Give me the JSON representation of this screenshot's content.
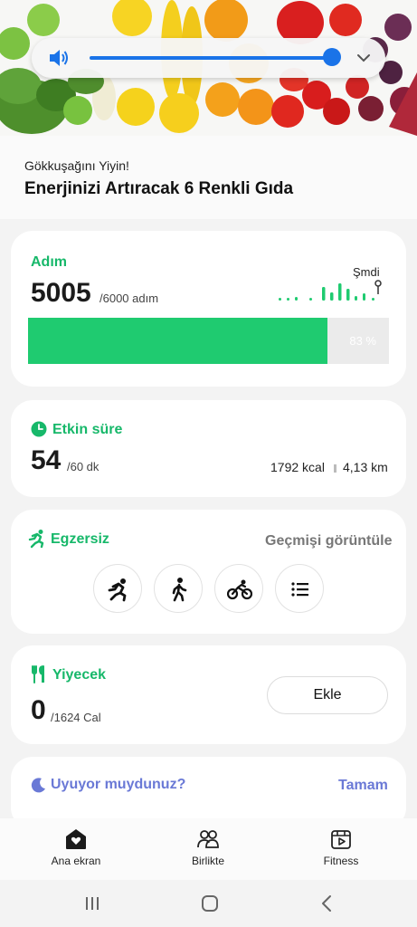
{
  "banner": {
    "subtitle": "Gökkuşağını Yiyin!",
    "title": "Enerjinizi Artıracak 6 Renkli Gıda"
  },
  "volume_panel": {
    "icon": "speaker-icon",
    "level": 0.9,
    "expand_icon": "chevron-down-icon",
    "accent": "#1a73e8"
  },
  "steps": {
    "title": "Adım",
    "value": "5005",
    "goal": "/6000 adım",
    "now_label": "Şmdi",
    "progress_percent": 83,
    "progress_label": "83 %",
    "accent": "#1fcb70"
  },
  "active_time": {
    "icon": "clock-icon",
    "title": "Etkin süre",
    "value": "54",
    "goal": "/60 dk",
    "calories": "1792 kcal",
    "distance": "4,13 km"
  },
  "exercise": {
    "icon": "running-icon",
    "title": "Egzersiz",
    "history_link": "Geçmişi görüntüle",
    "buttons": [
      {
        "icon": "running-icon"
      },
      {
        "icon": "walking-icon"
      },
      {
        "icon": "cycling-icon"
      },
      {
        "icon": "list-icon"
      }
    ]
  },
  "food": {
    "icon": "fork-knife-icon",
    "title": "Yiyecek",
    "value": "0",
    "goal": "/1624 Cal",
    "add_label": "Ekle"
  },
  "sleep": {
    "icon": "moon-icon",
    "title": "Uyuyor muydunuz?",
    "ok_label": "Tamam",
    "accent": "#6a79d6"
  },
  "bottom_nav": [
    {
      "label": "Ana ekran",
      "icon": "home-heart-icon"
    },
    {
      "label": "Birlikte",
      "icon": "people-icon"
    },
    {
      "label": "Fitness",
      "icon": "fitness-play-icon"
    }
  ],
  "system_nav": [
    "recents-icon",
    "home-icon",
    "back-icon"
  ]
}
